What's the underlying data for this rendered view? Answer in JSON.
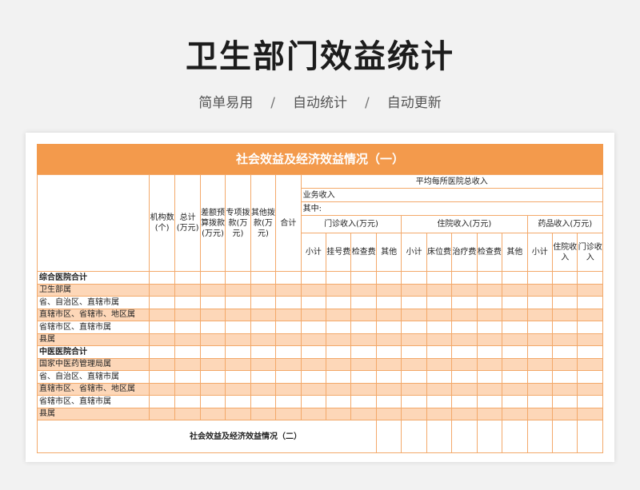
{
  "page": {
    "title": "卫生部门效益统计",
    "subtitle": [
      "简单易用",
      "自动统计",
      "自动更新"
    ],
    "subtitle_separator": "/"
  },
  "sheet": {
    "banner": "社会效益及经济效益情况（一）",
    "headers": {
      "institutions": "机构数(个)",
      "total": "总计(万元)",
      "diff_budget": "差额预算拨款(万元)",
      "special": "专项拨款(万元)",
      "other": "其他拨款(万元)",
      "subtotal": "合计",
      "avg_income": "平均每所医院总收入",
      "business_income": "业务收入",
      "of_which": "其中:",
      "outpatient": "门诊收入(万元)",
      "inpatient": "住院收入(万元)",
      "drug": "药品收入(万元)",
      "op_cols": [
        "小计",
        "挂号费",
        "检查费",
        "其他"
      ],
      "ip_cols": [
        "小计",
        "床位费",
        "治疗费",
        "检查费",
        "其他"
      ],
      "drug_cols": [
        "小计",
        "住院收入",
        "门诊收入"
      ]
    },
    "rows": [
      {
        "label": "综合医院合计",
        "bold": true
      },
      {
        "label": "卫生部属",
        "bold": false
      },
      {
        "label": "省、自治区、直辖市属",
        "bold": false
      },
      {
        "label": "直辖市区、省辖市、地区属",
        "bold": false
      },
      {
        "label": "省辖市区、直辖市属",
        "bold": false
      },
      {
        "label": "县属",
        "bold": false
      },
      {
        "label": "中医医院合计",
        "bold": true
      },
      {
        "label": "国家中医药管理局属",
        "bold": false
      },
      {
        "label": "省、自治区、直辖市属",
        "bold": false
      },
      {
        "label": "直辖市区、省辖市、地区属",
        "bold": false
      },
      {
        "label": "省辖市区、直辖市属",
        "bold": false
      },
      {
        "label": "县属",
        "bold": false
      }
    ],
    "footer": "社会效益及经济效益情况（二）"
  },
  "colors": {
    "accent": "#f39a4c",
    "stripe": "#fdd7b8",
    "border": "#f3a96a"
  }
}
